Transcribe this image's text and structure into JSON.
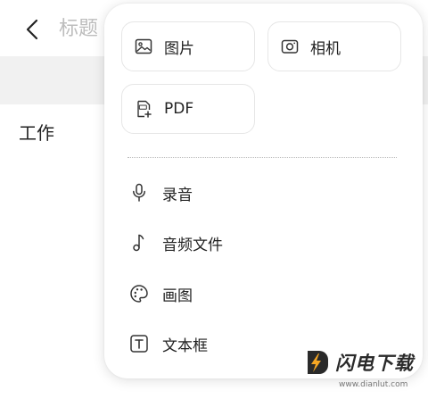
{
  "background": {
    "title": "标题",
    "folder": "工作"
  },
  "popup": {
    "tiles": [
      {
        "label": "图片",
        "icon": "image-icon"
      },
      {
        "label": "相机",
        "icon": "camera-icon"
      },
      {
        "label": "PDF",
        "icon": "pdf-icon"
      }
    ],
    "items": [
      {
        "label": "录音",
        "icon": "microphone-icon"
      },
      {
        "label": "音频文件",
        "icon": "music-note-icon"
      },
      {
        "label": "画图",
        "icon": "palette-icon"
      },
      {
        "label": "文本框",
        "icon": "text-box-icon"
      }
    ]
  },
  "watermark": {
    "brand": "闪电下载",
    "url": "www.dianlut.com"
  },
  "colors": {
    "text": "#222222",
    "muted_title": "#bdbdbd",
    "band": "#f1f1f1",
    "border": "#e6e6e6",
    "logo_accent": "#f5a623"
  }
}
